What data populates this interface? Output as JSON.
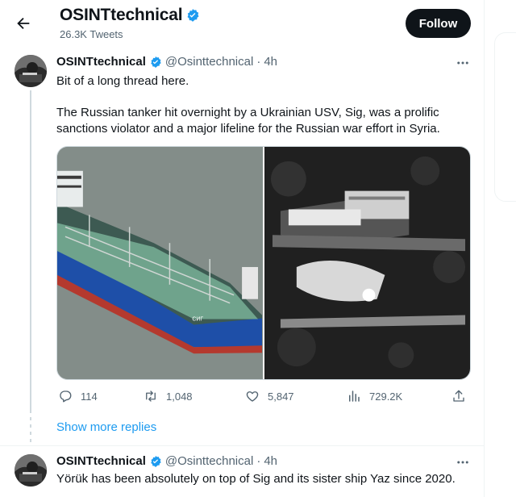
{
  "header": {
    "title": "OSINTtechnical",
    "tweet_count": "26.3K Tweets",
    "follow_label": "Follow"
  },
  "tweets": [
    {
      "name": "OSINTtechnical",
      "handle": "@Osinttechnical",
      "dot": "·",
      "time": "4h",
      "text_lines": [
        "Bit of a long thread here.",
        "The Russian tanker hit overnight by a Ukrainian USV, Sig, was a prolific",
        "sanctions violator and a major lifeline for the Russian war effort in Syria."
      ],
      "media": [
        {
          "alt": "tanker-photo",
          "hull_text": "СИГ"
        },
        {
          "alt": "night-thermal-footage"
        }
      ],
      "stats": {
        "replies": "114",
        "retweets": "1,048",
        "likes": "5,847",
        "views": "729.2K"
      }
    },
    {
      "name": "OSINTtechnical",
      "handle": "@Osinttechnical",
      "dot": "·",
      "time": "4h",
      "text_lines": [
        "Yörük has been absolutely on top of Sig and its sister ship Yaz since 2020."
      ]
    }
  ],
  "show_more_label": "Show more replies",
  "colors": {
    "accent": "#1d9bf0",
    "text": "#0f1419",
    "muted": "#536471",
    "verified": "#1d9bf0"
  },
  "icons": [
    "back-arrow-icon",
    "verified-badge-icon",
    "more-icon",
    "reply-icon",
    "retweet-icon",
    "like-icon",
    "views-icon",
    "share-icon"
  ]
}
